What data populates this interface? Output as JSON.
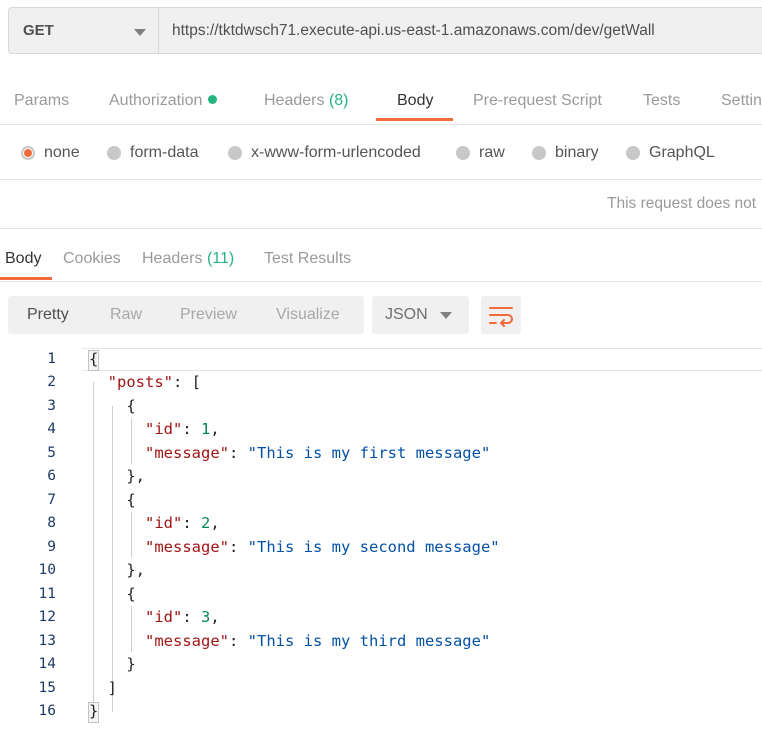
{
  "request": {
    "method": "GET",
    "url": "https://tktdwsch71.execute-api.us-east-1.amazonaws.com/dev/getWall"
  },
  "request_tabs": {
    "params": "Params",
    "authorization": "Authorization",
    "headers": "Headers",
    "headers_count": "(8)",
    "body": "Body",
    "prerequest": "Pre-request Script",
    "tests": "Tests",
    "settings": "Settin"
  },
  "body_types": [
    "none",
    "form-data",
    "x-www-form-urlencoded",
    "raw",
    "binary",
    "GraphQL"
  ],
  "notice": "This request does not",
  "response_tabs": {
    "body": "Body",
    "cookies": "Cookies",
    "headers": "Headers",
    "headers_count": "(11)",
    "test_results": "Test Results"
  },
  "view_modes": [
    "Pretty",
    "Raw",
    "Preview",
    "Visualize"
  ],
  "format": "JSON",
  "icons": {
    "wrap": "wrap-lines-icon",
    "caret": "chevron-down-icon"
  },
  "colors": {
    "accent": "#f26b3a",
    "count": "#26b47f"
  },
  "code": {
    "line_numbers": [
      "1",
      "2",
      "3",
      "4",
      "5",
      "6",
      "7",
      "8",
      "9",
      "10",
      "11",
      "12",
      "13",
      "14",
      "15",
      "16"
    ],
    "posts_key": "\"posts\"",
    "id_key": "\"id\"",
    "message_key": "\"message\"",
    "ids": [
      "1",
      "2",
      "3"
    ],
    "messages": [
      "\"This is my first message\"",
      "\"This is my second message\"",
      "\"This is my third message\""
    ]
  }
}
